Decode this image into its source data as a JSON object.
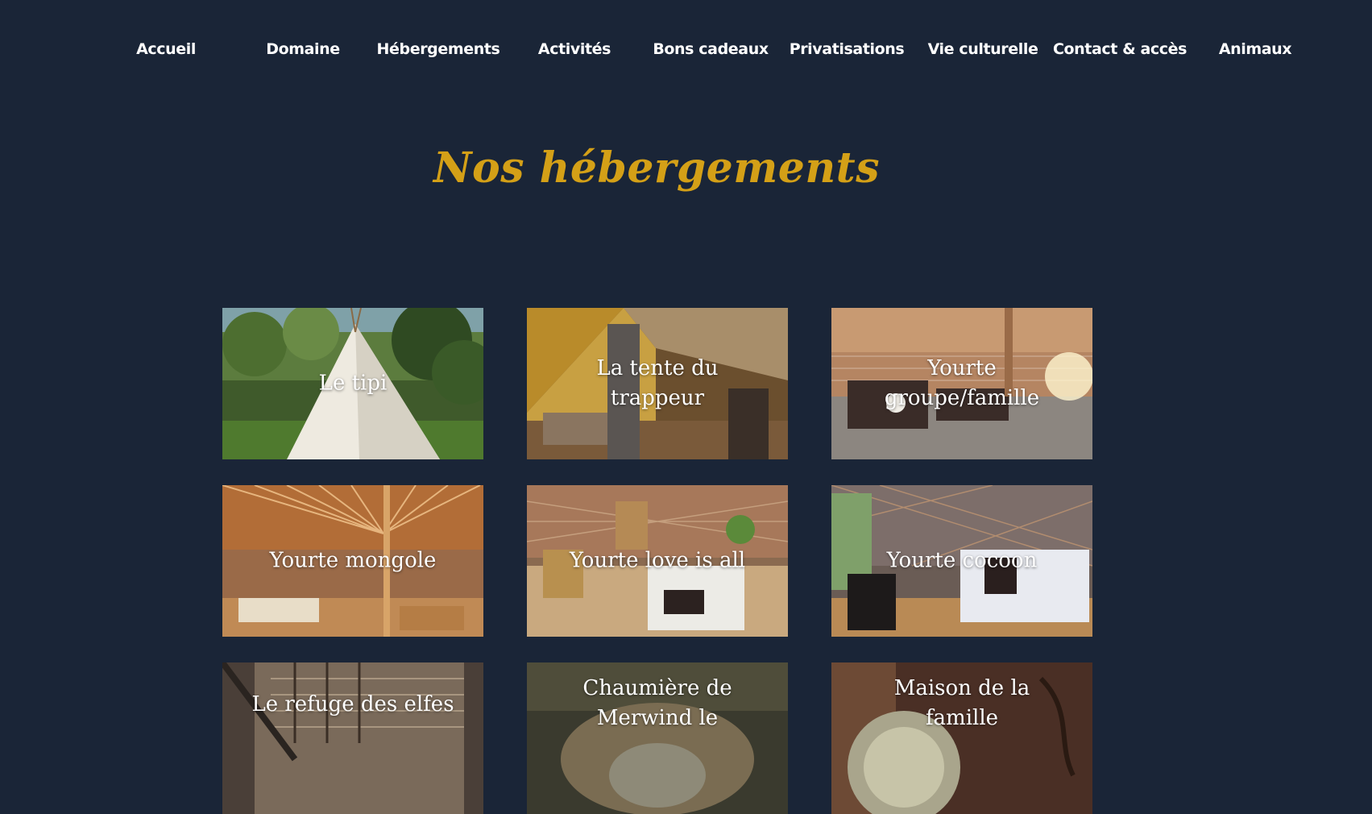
{
  "nav": {
    "items": [
      {
        "label": "Accueil"
      },
      {
        "label": "Domaine"
      },
      {
        "label": "Hébergements"
      },
      {
        "label": "Activités"
      },
      {
        "label": "Bons cadeaux"
      },
      {
        "label": "Privatisations"
      },
      {
        "label": "Vie culturelle"
      },
      {
        "label": "Contact & accès"
      },
      {
        "label": "Animaux"
      }
    ]
  },
  "main": {
    "title": "Nos hébergements",
    "cards": [
      {
        "label": "Le tipi"
      },
      {
        "label": "La tente du trappeur"
      },
      {
        "label": "Yourte groupe/famille"
      },
      {
        "label": "Yourte mongole"
      },
      {
        "label": "Yourte love is all"
      },
      {
        "label": "Yourte cocoon"
      },
      {
        "label": "Le refuge des elfes"
      },
      {
        "label": "Chaumière de Merwind le"
      },
      {
        "label": "Maison de la famille"
      }
    ]
  },
  "colors": {
    "background": "#1a2537",
    "title_accent": "#d4a017",
    "nav_text": "#ffffff"
  }
}
